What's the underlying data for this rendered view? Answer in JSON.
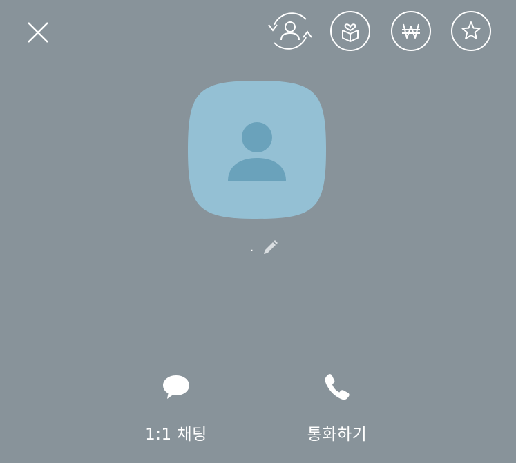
{
  "header": {
    "close_icon": "close-icon",
    "actions": [
      {
        "name": "switch-profile-icon"
      },
      {
        "name": "gift-icon"
      },
      {
        "name": "send-money-icon"
      },
      {
        "name": "favorite-star-icon"
      }
    ]
  },
  "profile": {
    "avatar_icon": "default-person-avatar-icon",
    "name": ".",
    "edit_icon": "pencil-edit-icon",
    "avatar_bg": "#94c0d4",
    "avatar_fg": "#6aa2bb"
  },
  "bottom_actions": [
    {
      "label": "1:1 채팅",
      "icon": "speech-bubble-icon"
    },
    {
      "label": "통화하기",
      "icon": "phone-icon"
    }
  ],
  "colors": {
    "background": "#88939a",
    "foreground": "#ffffff",
    "divider": "#b5bdc2"
  }
}
